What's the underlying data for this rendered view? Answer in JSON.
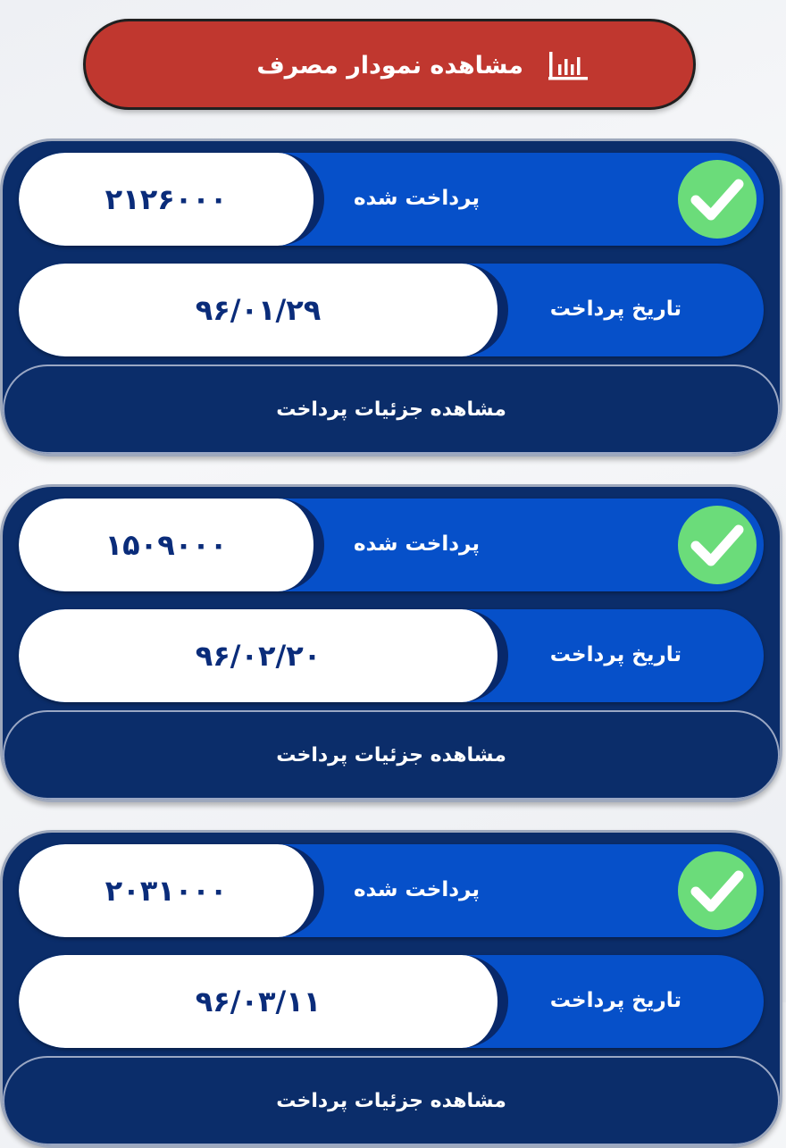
{
  "chart_button": {
    "label": "مشاهده نمودار مصرف",
    "icon": "bar-chart-icon"
  },
  "payments": [
    {
      "amount_label": "پرداخت شده",
      "amount": "۲۱۲۶۰۰۰",
      "date_label": "تاریخ پرداخت",
      "date": "۹۶/۰۱/۲۹",
      "details_label": "مشاهده جزئیات پرداخت",
      "status_icon": "check-icon"
    },
    {
      "amount_label": "پرداخت شده",
      "amount": "۱۵۰۹۰۰۰",
      "date_label": "تاریخ پرداخت",
      "date": "۹۶/۰۲/۲۰",
      "details_label": "مشاهده جزئیات پرداخت",
      "status_icon": "check-icon"
    },
    {
      "amount_label": "پرداخت شده",
      "amount": "۲۰۳۱۰۰۰",
      "date_label": "تاریخ پرداخت",
      "date": "۹۶/۰۳/۱۱",
      "details_label": "مشاهده جزئیات پرداخت",
      "status_icon": "check-icon"
    }
  ],
  "colors": {
    "chart_button": "#c0372f",
    "card_background": "#0b2d6a",
    "row_background": "#0650c9",
    "check_green": "#6bdc7a",
    "value_text": "#0a2c7a"
  }
}
